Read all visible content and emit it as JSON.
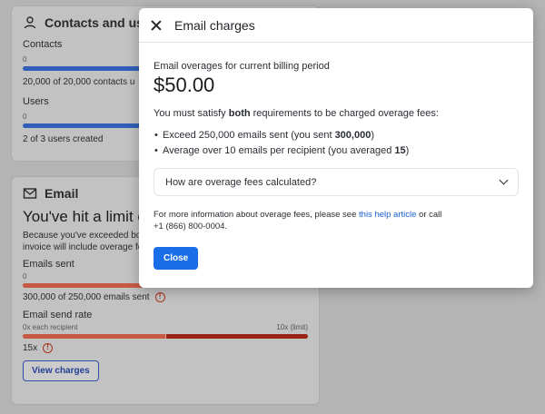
{
  "background": {
    "contacts_card": {
      "title": "Contacts and users",
      "contacts_label": "Contacts",
      "contacts_tick": "0",
      "contacts_usage": "20,000 of 20,000 contacts u",
      "users_label": "Users",
      "users_tick": "0",
      "users_usage": "2 of 3 users created"
    },
    "email_card": {
      "title": "Email",
      "headline": "You've hit a limit on e",
      "desc_line1": "Because you've exceeded bo",
      "desc_line2": "invoice will include overage fo",
      "emails_sent_label": "Emails sent",
      "emails_sent_tick": "0",
      "emails_sent_usage": "300,000 of 250,000 emails sent",
      "emails_sent_fill": 1.2,
      "send_rate_label": "Email send rate",
      "send_rate_tick_left": "0x each recipient",
      "send_rate_tick_right": "10x (limit)",
      "send_rate_value": "15x",
      "view_charges_label": "View charges"
    }
  },
  "modal": {
    "title": "Email charges",
    "overage_label": "Email overages for current billing period",
    "amount": "$50.00",
    "requirement_prefix": "You must satisfy ",
    "requirement_bold": "both",
    "requirement_suffix": " requirements to be charged overage fees:",
    "bullets": [
      {
        "prefix": "Exceed 250,000 emails sent (you sent ",
        "bold": "300,000",
        "suffix": ")"
      },
      {
        "prefix": "Average over 10 emails per recipient (you averaged ",
        "bold": "15",
        "suffix": ")"
      }
    ],
    "accordion_label": "How are overage fees calculated?",
    "more_info_prefix": "For more information about overage fees, please see ",
    "more_info_link": "this help article",
    "more_info_suffix": " or call",
    "phone": "+1 (866) 800-0004.",
    "close_label": "Close"
  },
  "icons": {
    "contacts": "user-icon",
    "email": "envelope-icon",
    "warning": "warning-circle-icon",
    "close": "close-icon",
    "chevron": "chevron-down-icon"
  },
  "colors": {
    "primary": "#1a6ee8",
    "link": "#1a5fd0",
    "danger": "#9a2418"
  }
}
